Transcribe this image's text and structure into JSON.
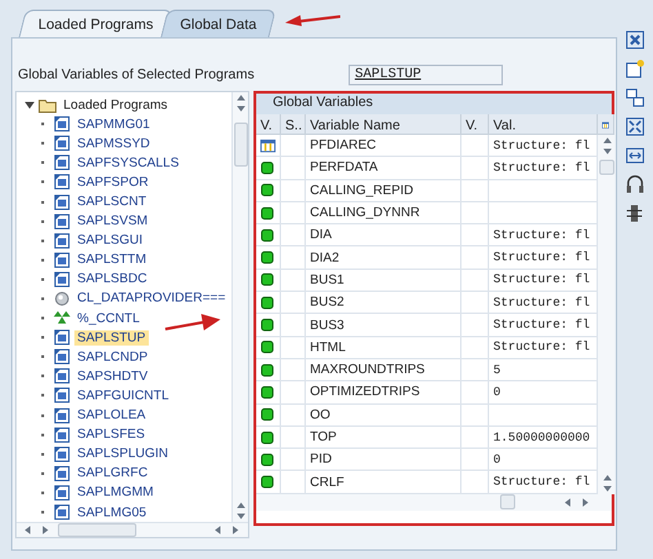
{
  "tabs": [
    {
      "label": "Loaded Programs",
      "selected": false
    },
    {
      "label": "Global Data",
      "selected": true
    }
  ],
  "program_field": {
    "label": "Global Variables of Selected Programs",
    "value": "SAPLSTUP"
  },
  "tree": {
    "label": "Loaded Programs",
    "expanded": true,
    "children": [
      {
        "label": "SAPMMG01",
        "kind": "program",
        "selected": false
      },
      {
        "label": "SAPMSSYD",
        "kind": "program",
        "selected": false
      },
      {
        "label": "SAPFSYSCALLS",
        "kind": "program",
        "selected": false
      },
      {
        "label": "SAPFSPOR",
        "kind": "program",
        "selected": false
      },
      {
        "label": "SAPLSCNT",
        "kind": "program",
        "selected": false
      },
      {
        "label": "SAPLSVSM",
        "kind": "program",
        "selected": false
      },
      {
        "label": "SAPLSGUI",
        "kind": "program",
        "selected": false
      },
      {
        "label": "SAPLSTTM",
        "kind": "program",
        "selected": false
      },
      {
        "label": "SAPLSBDC",
        "kind": "program",
        "selected": false
      },
      {
        "label": "CL_DATAPROVIDER===",
        "kind": "class",
        "selected": false
      },
      {
        "label": "%_CCNTL",
        "kind": "control",
        "selected": false
      },
      {
        "label": "SAPLSTUP",
        "kind": "program",
        "selected": true
      },
      {
        "label": "SAPLCNDP",
        "kind": "program",
        "selected": false
      },
      {
        "label": "SAPSHDTV",
        "kind": "program",
        "selected": false
      },
      {
        "label": "SAPFGUICNTL",
        "kind": "program",
        "selected": false
      },
      {
        "label": "SAPLOLEA",
        "kind": "program",
        "selected": false
      },
      {
        "label": "SAPLSFES",
        "kind": "program",
        "selected": false
      },
      {
        "label": "SAPLSPLUGIN",
        "kind": "program",
        "selected": false
      },
      {
        "label": "SAPLGRFC",
        "kind": "program",
        "selected": false
      },
      {
        "label": "SAPLMGMM",
        "kind": "program",
        "selected": false
      },
      {
        "label": "SAPLMG05",
        "kind": "program",
        "selected": false
      }
    ]
  },
  "table": {
    "title": "Global Variables",
    "columns": [
      "V.",
      "S..",
      "Variable Name",
      "V.",
      "Val."
    ],
    "rows": [
      {
        "kind": "structure",
        "name": "PFDIAREC",
        "value": "Structure: fl"
      },
      {
        "kind": "field",
        "name": "PERFDATA",
        "value": "Structure: fl"
      },
      {
        "kind": "field",
        "name": "CALLING_REPID"
      },
      {
        "kind": "field",
        "name": "CALLING_DYNNR"
      },
      {
        "kind": "field",
        "name": "DIA",
        "value": "Structure: fl"
      },
      {
        "kind": "field",
        "name": "DIA2",
        "value": "Structure: fl"
      },
      {
        "kind": "field",
        "name": "BUS1",
        "value": "Structure: fl"
      },
      {
        "kind": "field",
        "name": "BUS2",
        "value": "Structure: fl"
      },
      {
        "kind": "field",
        "name": "BUS3",
        "value": "Structure: fl"
      },
      {
        "kind": "field",
        "name": "HTML",
        "value": "Structure: fl"
      },
      {
        "kind": "field",
        "name": "MAXROUNDTRIPS",
        "value": "5"
      },
      {
        "kind": "field",
        "name": "OPTIMIZEDTRIPS",
        "value": "0"
      },
      {
        "kind": "field",
        "name": "OO"
      },
      {
        "kind": "field",
        "name": "TOP",
        "value": "1.50000000000"
      },
      {
        "kind": "field",
        "name": "PID",
        "value": "0"
      },
      {
        "kind": "field",
        "name": "CRLF",
        "value": "Structure: fl"
      }
    ]
  }
}
